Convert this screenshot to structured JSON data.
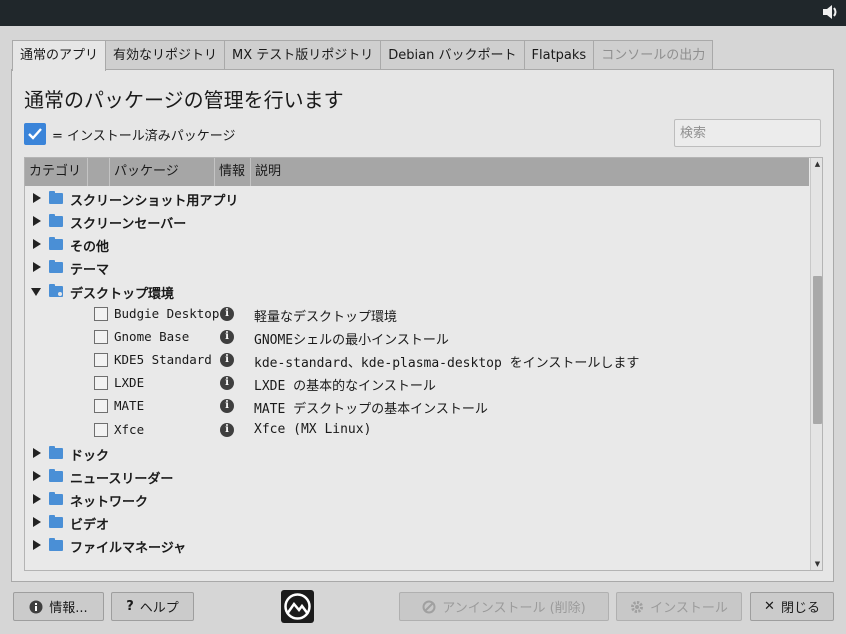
{
  "tabs": [
    {
      "label": "通常のアプリ",
      "active": true,
      "disabled": false
    },
    {
      "label": "有効なリポジトリ",
      "active": false,
      "disabled": false
    },
    {
      "label": "MX テスト版リポジトリ",
      "active": false,
      "disabled": false
    },
    {
      "label": "Debian バックポート",
      "active": false,
      "disabled": false
    },
    {
      "label": "Flatpaks",
      "active": false,
      "disabled": false
    },
    {
      "label": "コンソールの出力",
      "active": false,
      "disabled": true
    }
  ],
  "heading": "通常のパッケージの管理を行います",
  "legend": "= インストール済みパッケージ",
  "search": {
    "placeholder": "検索",
    "value": ""
  },
  "columns": {
    "category": "カテゴリ",
    "package": "パッケージ",
    "info": "情報",
    "description": "説明"
  },
  "tree": [
    {
      "type": "category",
      "label": "スクリーンショット用アプリ",
      "expanded": false
    },
    {
      "type": "category",
      "label": "スクリーンセーバー",
      "expanded": false
    },
    {
      "type": "category",
      "label": "その他",
      "expanded": false
    },
    {
      "type": "category",
      "label": "テーマ",
      "expanded": false
    },
    {
      "type": "category",
      "label": "デスクトップ環境",
      "expanded": true
    },
    {
      "type": "package",
      "name": "Budgie Desktop",
      "description": "軽量なデスクトップ環境",
      "checked": false
    },
    {
      "type": "package",
      "name": "Gnome Base",
      "description": "GNOMEシェルの最小インストール",
      "checked": false
    },
    {
      "type": "package",
      "name": "KDE5 Standard",
      "description": "kde-standard、kde-plasma-desktop をインストールします",
      "checked": false
    },
    {
      "type": "package",
      "name": "LXDE",
      "description": "LXDE の基本的なインストール",
      "checked": false
    },
    {
      "type": "package",
      "name": "MATE",
      "description": "MATE デスクトップの基本インストール",
      "checked": false
    },
    {
      "type": "package",
      "name": "Xfce",
      "description": "Xfce (MX Linux)",
      "checked": false
    },
    {
      "type": "category",
      "label": "ドック",
      "expanded": false
    },
    {
      "type": "category",
      "label": "ニュースリーダー",
      "expanded": false
    },
    {
      "type": "category",
      "label": "ネットワーク",
      "expanded": false
    },
    {
      "type": "category",
      "label": "ビデオ",
      "expanded": false
    },
    {
      "type": "category",
      "label": "ファイルマネージャ",
      "expanded": false
    }
  ],
  "buttons": {
    "about": "情報...",
    "help": "ヘルプ",
    "uninstall": "アンインストール (削除)",
    "install": "インストール",
    "close": "閉じる"
  },
  "colors": {
    "accent": "#3a84d9",
    "folder": "#4a8fd6",
    "header": "#a6a6a6"
  }
}
